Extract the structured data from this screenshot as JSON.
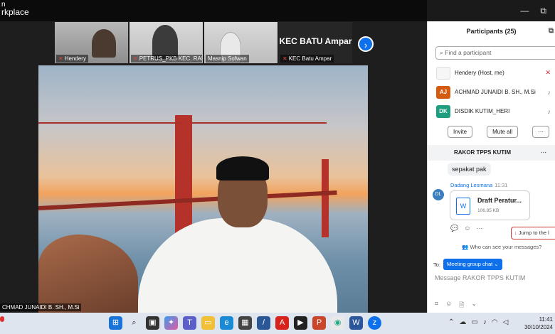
{
  "app": {
    "title_line1": "n",
    "title_line2": "rkplace"
  },
  "window_controls": {
    "minimize": "—",
    "restore": "⧉"
  },
  "video_strip": {
    "tiles": [
      {
        "name": "Hendery",
        "muted": true
      },
      {
        "name": "PETRUS_PKB KEC. RAN...",
        "muted": true
      },
      {
        "name": "Masnip Sofwan",
        "muted": false
      },
      {
        "name": "KEC Batu Ampar",
        "muted": true,
        "display": "KEC BATU Ampar"
      }
    ],
    "next": "›"
  },
  "main_video": {
    "speaker_name": "CHMAD JUNAIDI B. SH., M.Si"
  },
  "participants": {
    "title": "Participants (25)",
    "popout": "⧉",
    "search_placeholder": "Find a participant",
    "list": [
      {
        "initials": "",
        "name": "Hendery (Host, me)",
        "mic": "off"
      },
      {
        "initials": "AJ",
        "name": "ACHMAD JUNAIDI B. SH., M.Si",
        "mic": "on"
      },
      {
        "initials": "DK",
        "name": "DISDIK KUTIM_HERI",
        "mic": "on"
      }
    ],
    "invite_label": "Invite",
    "mute_all_label": "Mute all",
    "more_label": "⋯"
  },
  "chat": {
    "title": "RAKOR TPPS KUTIM",
    "more": "⋯",
    "message1": "sepakat pak",
    "sender_initials": "DL",
    "sender_name": "Dadang Lesmana",
    "sender_time": "11:31",
    "file_name": "Draft Peratur...",
    "file_size": "106.85 KB",
    "file_icon": "W",
    "jump_label": "Jump to the l",
    "who_can_see": "Who can see your messages?",
    "to_label": "To:",
    "recipient": "Meeting group chat ⌄",
    "input_placeholder": "Message RAKOR TPPS KUTIM"
  },
  "taskbar": {
    "time": "11:41",
    "date": "30/10/2024",
    "icons": [
      "windows-icon",
      "search-icon",
      "taskview-icon",
      "copilot-icon",
      "teams-icon",
      "explorer-icon",
      "edge-icon",
      "store-icon",
      "app-icon",
      "acrobat-icon",
      "media-icon",
      "powerpoint-icon",
      "chrome-icon",
      "word-icon",
      "zoom-icon"
    ]
  },
  "colors": {
    "accent": "#0e71eb",
    "muted_red": "#e0473e"
  }
}
